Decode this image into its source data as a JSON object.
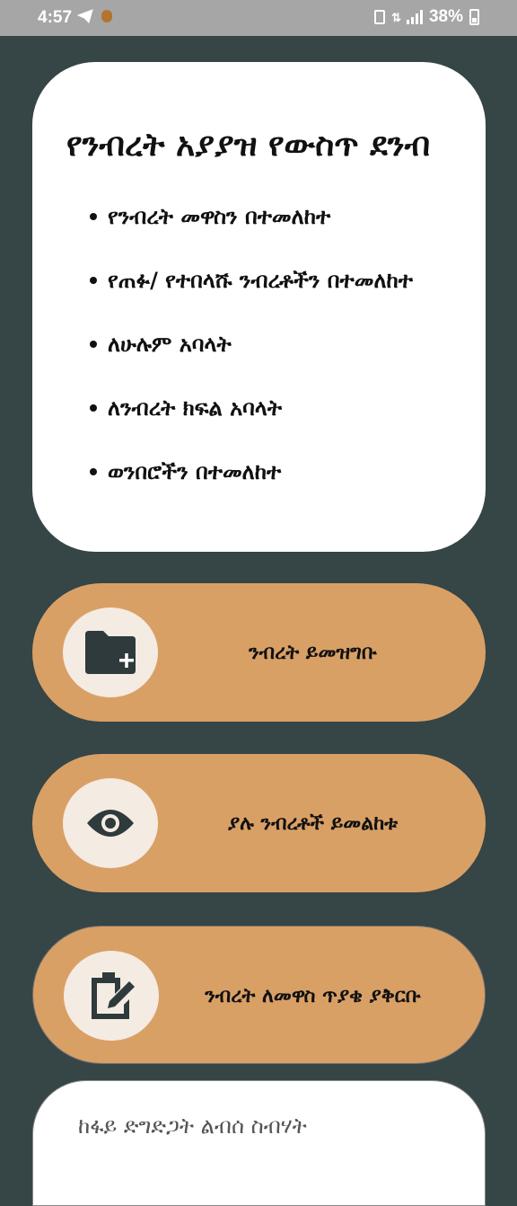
{
  "status_bar": {
    "time": "4:57",
    "battery": "38%",
    "icons": [
      "telegram-send-icon",
      "app-notification-icon",
      "battery-saver-icon",
      "data-arrows-icon",
      "signal-icon",
      "battery-icon"
    ]
  },
  "info_card": {
    "title": "የንብረት አያያዝ የውስጥ ደንብ",
    "items": [
      "የንብረት መዋስን በተመለከተ",
      "የጠፉ/ የተበላሹ ንብረቶችን በተመለከተ",
      "ለሁሉም አባላት",
      "ለንብረት ክፍል አባላት",
      "ወንበሮችን በተመለከተ"
    ]
  },
  "actions": [
    {
      "label": "ንብረት ይመዝግቡ",
      "icon": "folder-add-icon"
    },
    {
      "label": "ያሉ ንብረቶች ይመልከቱ",
      "icon": "eye-icon"
    },
    {
      "label": "ንብረት ለመዋስ ጥያቄ ያቅርቡ",
      "icon": "request-form-icon"
    }
  ],
  "bottom_card": {
    "text": "ከፋይ ድግድጋት ልብሰ ስብሃት"
  },
  "colors": {
    "background": "#364546",
    "pill": "#d9a066",
    "icon_circle": "#f4ebe3",
    "icon_fg": "#2e3a3b"
  }
}
